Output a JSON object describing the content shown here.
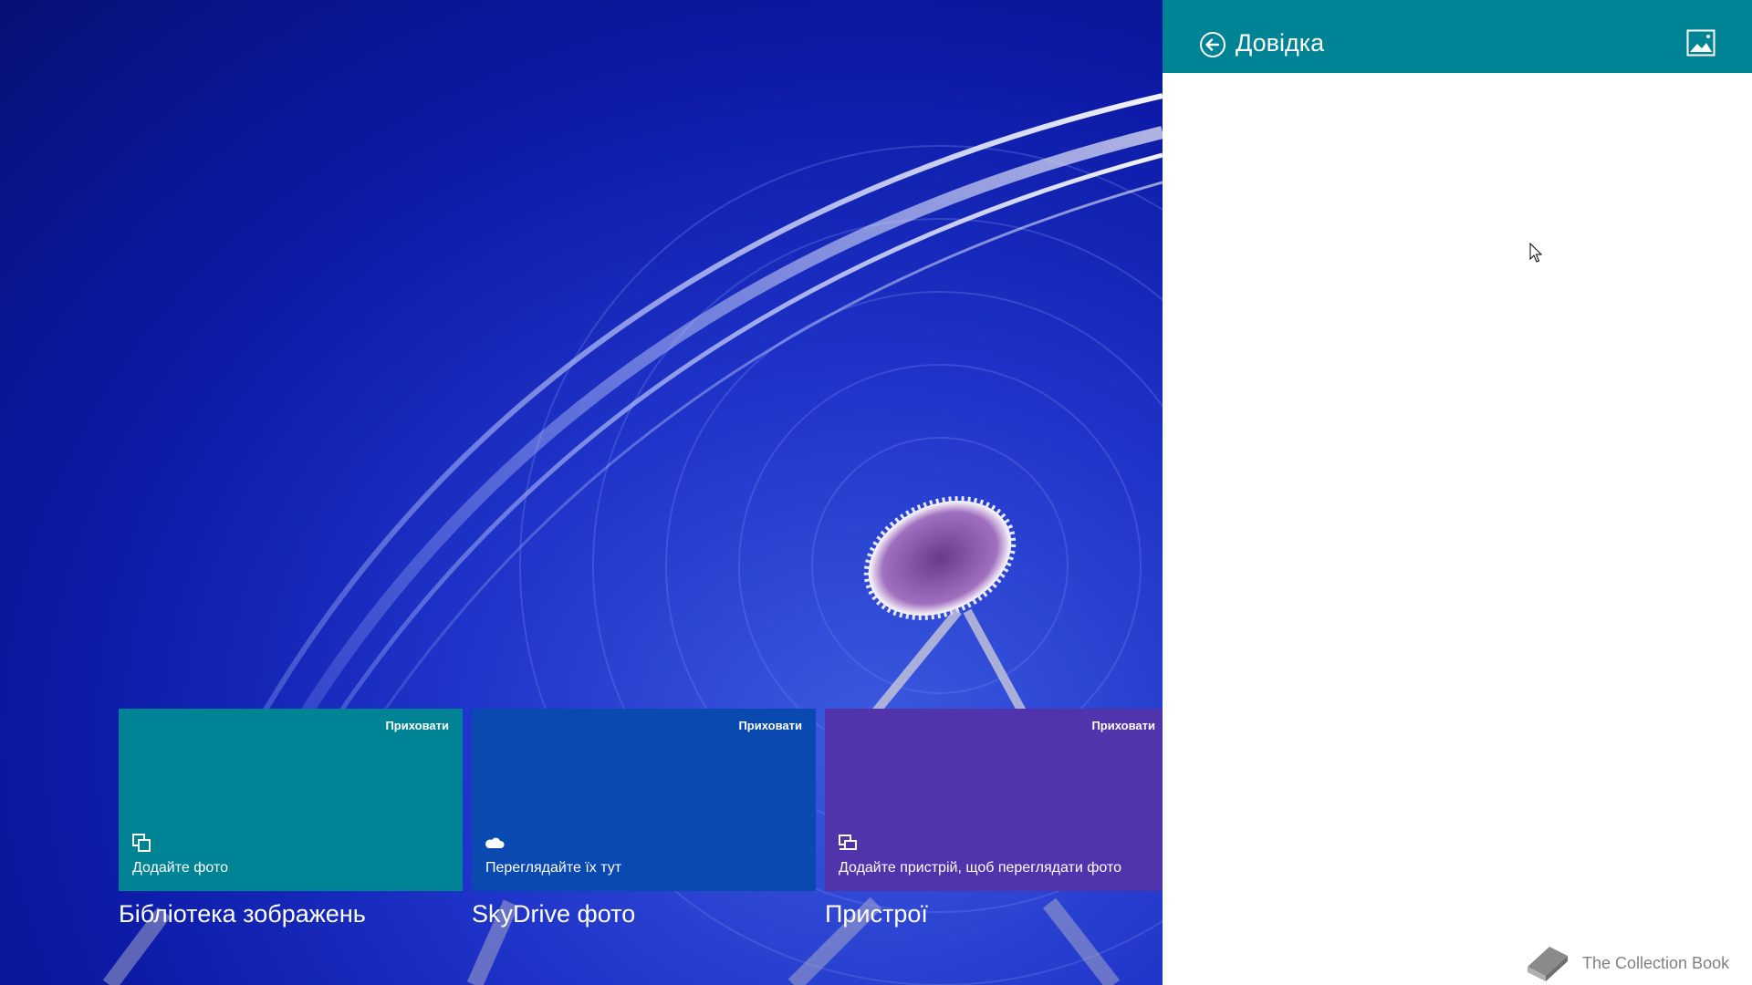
{
  "tiles": [
    {
      "hide_label": "Приховати",
      "text": "Додайте фото",
      "title": "Бібліотека зображень",
      "icon": "copy-icon",
      "color": "#008394"
    },
    {
      "hide_label": "Приховати",
      "text": "Переглядайте їх тут",
      "title": "SkyDrive фото",
      "icon": "cloud-icon",
      "color": "#0a49b0"
    },
    {
      "hide_label": "Приховати",
      "text": "Додайте пристрій, щоб переглядати фото",
      "title": "Пристрої",
      "icon": "devices-icon",
      "color": "#5133ab"
    }
  ],
  "pane": {
    "title": "Довідка",
    "back_icon": "back-arrow-icon",
    "image_icon": "image-icon",
    "header_color": "#008394"
  },
  "brand": {
    "text": "The Collection Book",
    "icon": "book-icon"
  }
}
